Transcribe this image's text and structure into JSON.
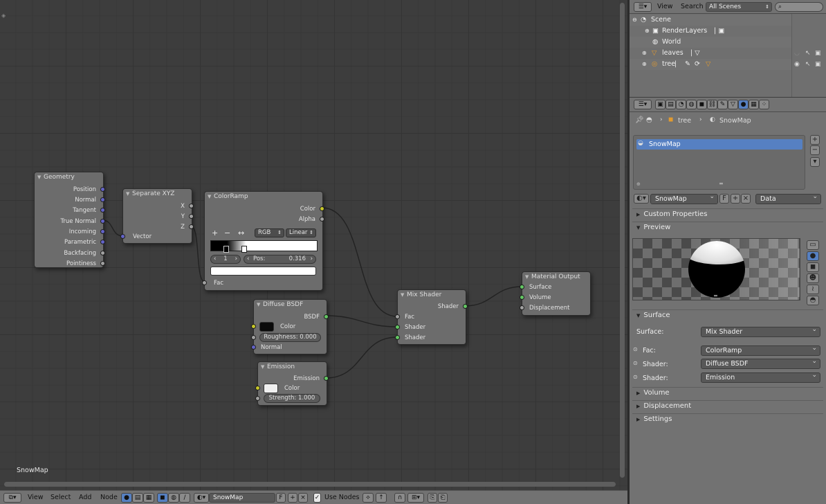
{
  "editor": {
    "material_label": "SnowMap",
    "nodes": {
      "geometry": {
        "title": "Geometry",
        "outputs": [
          "Position",
          "Normal",
          "Tangent",
          "True Normal",
          "Incoming",
          "Parametric",
          "Backfacing",
          "Pointiness"
        ]
      },
      "separate_xyz": {
        "title": "Separate XYZ",
        "outputs": [
          "X",
          "Y",
          "Z"
        ],
        "input": "Vector"
      },
      "colorramp": {
        "title": "ColorRamp",
        "outputs": [
          "Color",
          "Alpha"
        ],
        "add": "+",
        "remove": "−",
        "flip": "↔",
        "mode": "RGB",
        "interp": "Linear",
        "index": "1",
        "pos_label": "Pos:",
        "pos_value": "0.316",
        "input": "Fac"
      },
      "diffuse": {
        "title": "Diffuse BSDF",
        "output": "BSDF",
        "color_label": "Color",
        "roughness": "Roughness: 0.000",
        "normal_label": "Normal",
        "color_swatch": "#0a0a0a"
      },
      "emission": {
        "title": "Emission",
        "output": "Emission",
        "color_label": "Color",
        "strength": "Strength: 1.000",
        "color_swatch": "#f0f0f0"
      },
      "mix": {
        "title": "Mix Shader",
        "output": "Shader",
        "inputs": [
          "Fac",
          "Shader",
          "Shader"
        ]
      },
      "output": {
        "title": "Material Output",
        "inputs": [
          "Surface",
          "Volume",
          "Displacement"
        ]
      }
    }
  },
  "bottom_bar": {
    "menus": [
      "View",
      "Select",
      "Add",
      "Node"
    ],
    "material_name": "SnowMap",
    "fake_user": "F",
    "use_nodes_label": "Use Nodes"
  },
  "outliner": {
    "header": {
      "view": "View",
      "search": "Search",
      "scene_select": "All Scenes"
    },
    "rows": [
      {
        "name": "Scene"
      },
      {
        "name": "RenderLayers"
      },
      {
        "name": "World"
      },
      {
        "name": "leaves"
      },
      {
        "name": "tree"
      }
    ]
  },
  "properties": {
    "breadcrumb": {
      "object": "tree",
      "material": "SnowMap"
    },
    "slot_name": "SnowMap",
    "material_name": "SnowMap",
    "fake_user": "F",
    "link_mode": "Data",
    "panels": {
      "custom": "Custom Properties",
      "preview": "Preview",
      "surface": "Surface",
      "volume": "Volume",
      "displacement": "Displacement",
      "settings": "Settings"
    },
    "surface": {
      "surface_label": "Surface:",
      "surface_value": "Mix Shader",
      "fac_label": "Fac:",
      "fac_value": "ColorRamp",
      "shader1_label": "Shader:",
      "shader1_value": "Diffuse BSDF",
      "shader2_label": "Shader:",
      "shader2_value": "Emission"
    }
  },
  "colors": {
    "selected_row": "#5680c2",
    "socket_shader": "#63c763",
    "socket_color": "#c7c729",
    "socket_vector": "#6363c7"
  }
}
